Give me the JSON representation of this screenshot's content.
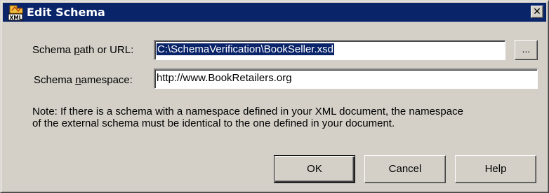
{
  "window": {
    "title": "Edit Schema",
    "close_glyph": "✕",
    "title_icon": "xml-schema-icon"
  },
  "form": {
    "path_label_pre": "Schema ",
    "path_label_accel": "p",
    "path_label_post": "ath or URL:",
    "path_value": "C:\\SchemaVerification\\BookSeller.xsd",
    "browse_label": "...",
    "ns_label_pre": "Schema ",
    "ns_label_accel": "n",
    "ns_label_post": "amespace:",
    "ns_value": "http://www.BookRetailers.org"
  },
  "note": {
    "line1": "Note: If there is a schema with a namespace defined in your XML document, the namespace",
    "line2": "of the external schema must be identical to the one defined in your document."
  },
  "buttons": {
    "ok": "OK",
    "cancel": "Cancel",
    "help": "Help"
  },
  "colors": {
    "titlebar": "#0a246a",
    "dialog_face": "#d4d0c8",
    "selection": "#0a246a"
  }
}
